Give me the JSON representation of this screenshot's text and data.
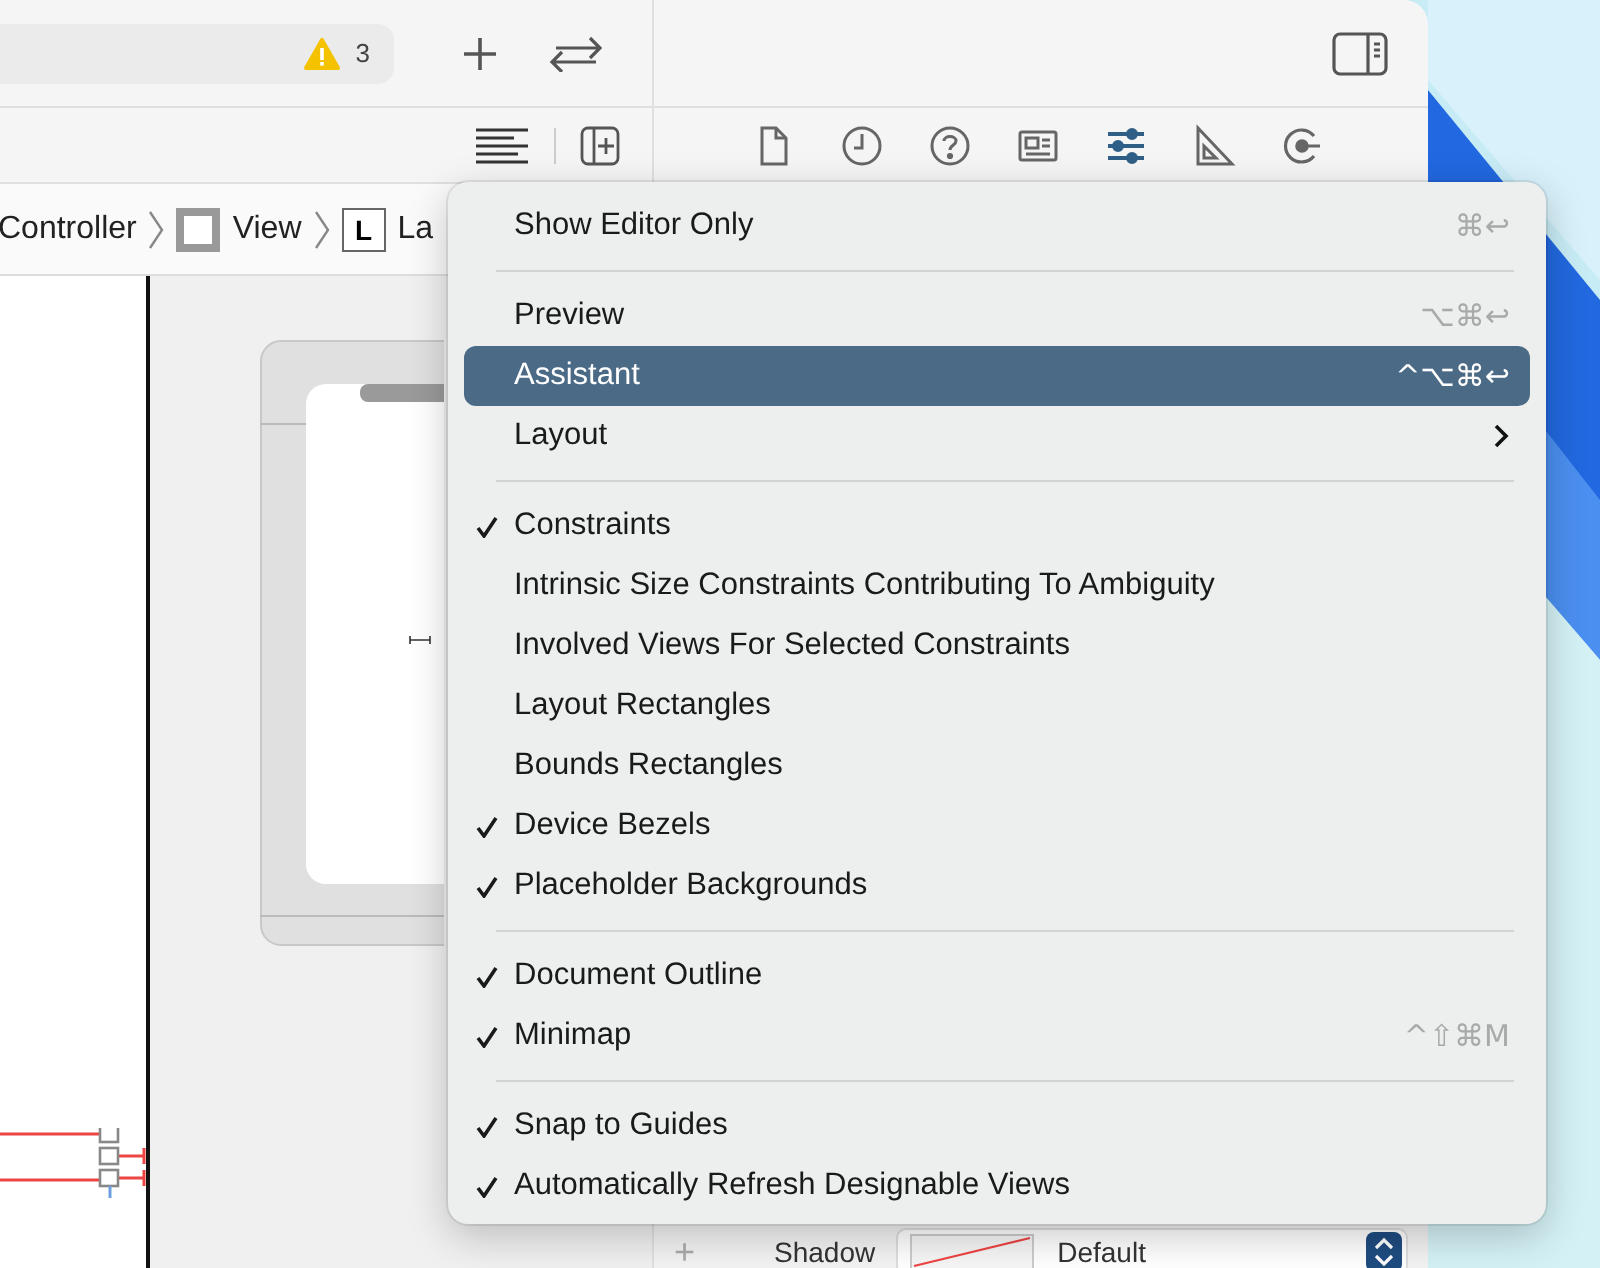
{
  "toolbar": {
    "warning_count": "3"
  },
  "inspector_tabs": [
    {
      "kind": "file",
      "selected": false
    },
    {
      "kind": "history",
      "selected": false
    },
    {
      "kind": "help",
      "selected": false
    },
    {
      "kind": "identity",
      "selected": false
    },
    {
      "kind": "attributes",
      "selected": true
    },
    {
      "kind": "size",
      "selected": false
    },
    {
      "kind": "connections",
      "selected": false
    }
  ],
  "breadcrumb": [
    {
      "kind": "plain",
      "label": "Controller"
    },
    {
      "kind": "view",
      "label": "View"
    },
    {
      "kind": "letter",
      "letter": "L",
      "label": "La"
    }
  ],
  "inspector": {
    "add": "+",
    "label": "Shadow",
    "value": "Default"
  },
  "menu": [
    [
      {
        "label": "Show Editor Only",
        "shortcut": "⌘↩",
        "checked": false,
        "selected": false,
        "submenu": false
      }
    ],
    [
      {
        "label": "Preview",
        "shortcut": "⌥⌘↩",
        "checked": false,
        "selected": false,
        "submenu": false
      },
      {
        "label": "Assistant",
        "shortcut": "^⌥⌘↩",
        "checked": false,
        "selected": true,
        "submenu": false
      },
      {
        "label": "Layout",
        "checked": false,
        "selected": false,
        "submenu": true
      }
    ],
    [
      {
        "label": "Constraints",
        "checked": true,
        "selected": false,
        "submenu": false
      },
      {
        "label": "Intrinsic Size Constraints Contributing To Ambiguity",
        "checked": false,
        "selected": false,
        "submenu": false
      },
      {
        "label": "Involved Views For Selected Constraints",
        "checked": false,
        "selected": false,
        "submenu": false
      },
      {
        "label": "Layout Rectangles",
        "checked": false,
        "selected": false,
        "submenu": false
      },
      {
        "label": "Bounds Rectangles",
        "checked": false,
        "selected": false,
        "submenu": false
      },
      {
        "label": "Device Bezels",
        "checked": true,
        "selected": false,
        "submenu": false
      },
      {
        "label": "Placeholder Backgrounds",
        "checked": true,
        "selected": false,
        "submenu": false
      }
    ],
    [
      {
        "label": "Document Outline",
        "checked": true,
        "selected": false,
        "submenu": false
      },
      {
        "label": "Minimap",
        "shortcut": "^⇧⌘M",
        "checked": true,
        "selected": false,
        "submenu": false
      }
    ],
    [
      {
        "label": "Snap to Guides",
        "checked": true,
        "selected": false,
        "submenu": false
      },
      {
        "label": "Automatically Refresh Designable Views",
        "checked": true,
        "selected": false,
        "submenu": false
      }
    ]
  ]
}
